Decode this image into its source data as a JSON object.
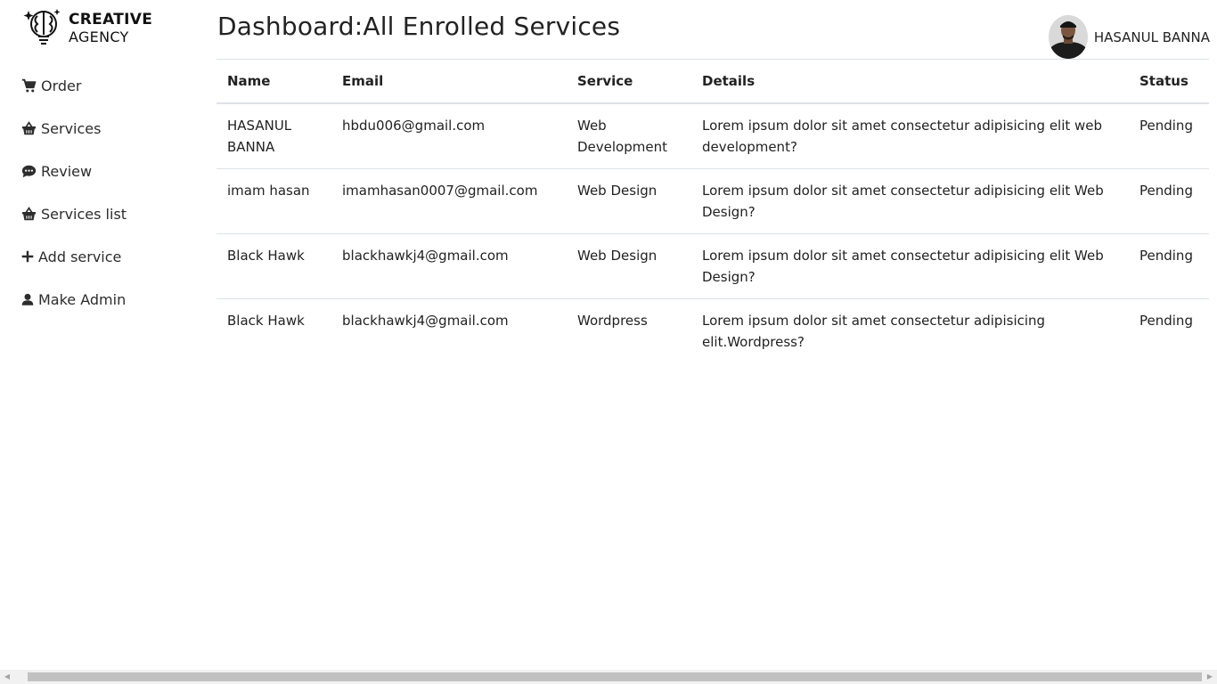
{
  "brand": {
    "line1": "CREATIVE",
    "line2": "AGENCY",
    "logo_icon": "brain-bulb-icon"
  },
  "sidebar": {
    "items": [
      {
        "label": "Order",
        "icon": "cart-icon"
      },
      {
        "label": "Services",
        "icon": "basket-icon"
      },
      {
        "label": "Review",
        "icon": "comment-dots-icon"
      },
      {
        "label": "Services list",
        "icon": "basket-icon"
      },
      {
        "label": "Add service",
        "icon": "plus-icon"
      },
      {
        "label": "Make Admin",
        "icon": "user-icon"
      }
    ]
  },
  "header": {
    "title": "Dashboard:All Enrolled Services"
  },
  "user": {
    "name": "HASANUL BANNA"
  },
  "table": {
    "columns": [
      "Name",
      "Email",
      "Service",
      "Details",
      "Status"
    ],
    "rows": [
      {
        "name": "HASANUL BANNA",
        "email": "hbdu006@gmail.com",
        "service": "Web Development",
        "details": "Lorem ipsum dolor sit amet consectetur adipisicing elit web development?",
        "status": "Pending"
      },
      {
        "name": "imam hasan",
        "email": "imamhasan0007@gmail.com",
        "service": "Web Design",
        "details": "Lorem ipsum dolor sit amet consectetur adipisicing elit Web Design?",
        "status": "Pending"
      },
      {
        "name": "Black Hawk",
        "email": "blackhawkj4@gmail.com",
        "service": "Web Design",
        "details": "Lorem ipsum dolor sit amet consectetur adipisicing elit Web Design?",
        "status": "Pending"
      },
      {
        "name": "Black Hawk",
        "email": "blackhawkj4@gmail.com",
        "service": "Wordpress",
        "details": "Lorem ipsum dolor sit amet consectetur adipisicing elit.Wordpress?",
        "status": "Pending"
      }
    ]
  },
  "scrollbar": {
    "left_arrow": "◀",
    "right_arrow": "▶"
  }
}
